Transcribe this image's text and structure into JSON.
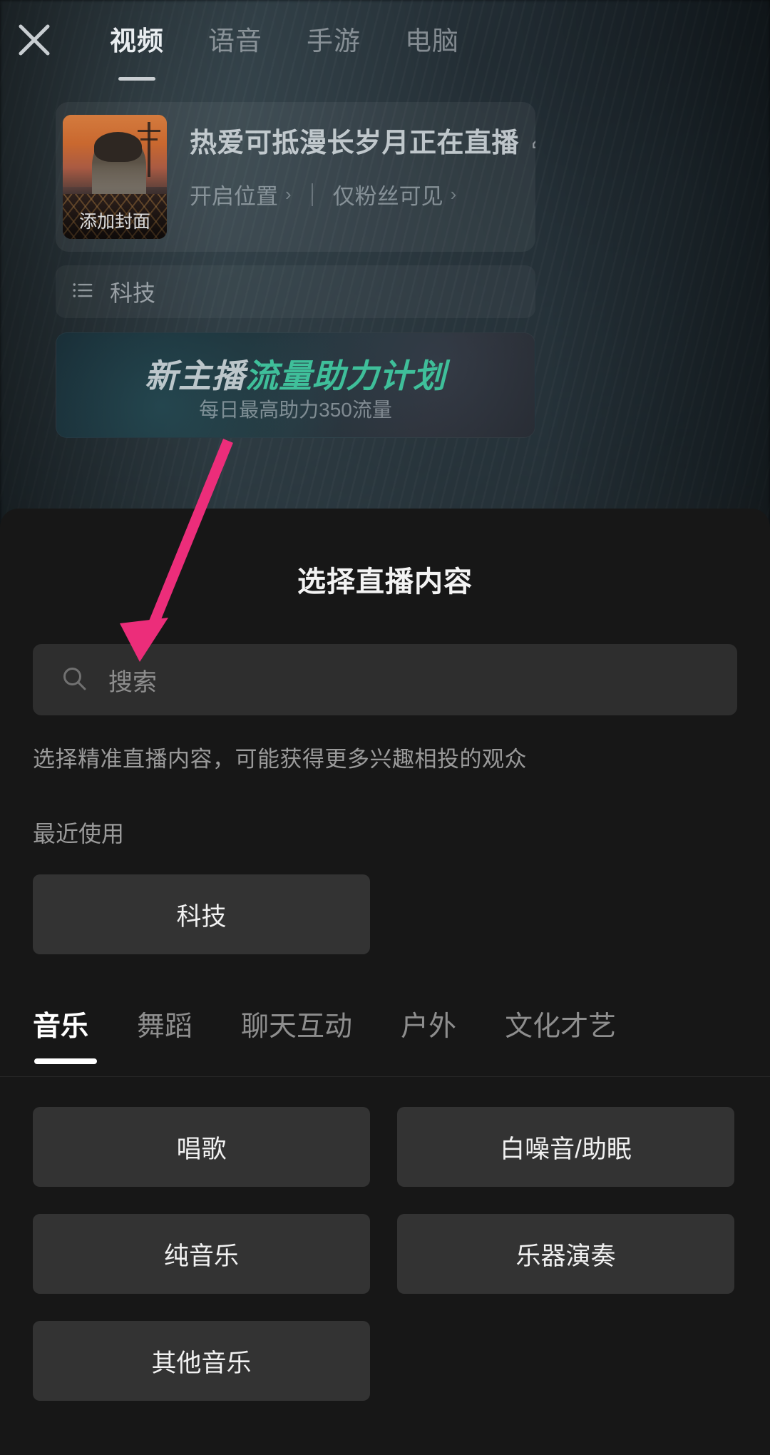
{
  "topbar": {
    "close_icon": "close-icon",
    "tabs": [
      {
        "label": "视频",
        "active": true
      },
      {
        "label": "语音",
        "active": false
      },
      {
        "label": "手游",
        "active": false
      },
      {
        "label": "电脑",
        "active": false
      }
    ]
  },
  "setup_card": {
    "cover_label": "添加封面",
    "live_title": "热爱可抵漫长岁月正在直播",
    "edit_icon": "pencil-icon",
    "location_label": "开启位置",
    "visibility_label": "仅粉丝可见",
    "chevron": "›"
  },
  "category_row": {
    "icon": "list-icon",
    "label": "科技"
  },
  "promo": {
    "title_plain": "新主播",
    "title_accent": "流量助力计划",
    "subtitle": "每日最高助力350流量",
    "accent_color": "#3fbf9a"
  },
  "sheet": {
    "title": "选择直播内容",
    "search": {
      "icon": "search-icon",
      "placeholder": "搜索",
      "value": ""
    },
    "hint": "选择精准直播内容，可能获得更多兴趣相投的观众",
    "recent_label": "最近使用",
    "recent_items": [
      "科技"
    ],
    "subtabs": [
      {
        "label": "音乐",
        "active": true
      },
      {
        "label": "舞蹈",
        "active": false
      },
      {
        "label": "聊天互动",
        "active": false
      },
      {
        "label": "户外",
        "active": false
      },
      {
        "label": "文化才艺",
        "active": false
      }
    ],
    "grid_items": [
      "唱歌",
      "白噪音/助眠",
      "纯音乐",
      "乐器演奏",
      "其他音乐"
    ]
  },
  "annotation": {
    "arrow_color": "#ec2d7a",
    "name": "annotation-arrow"
  }
}
